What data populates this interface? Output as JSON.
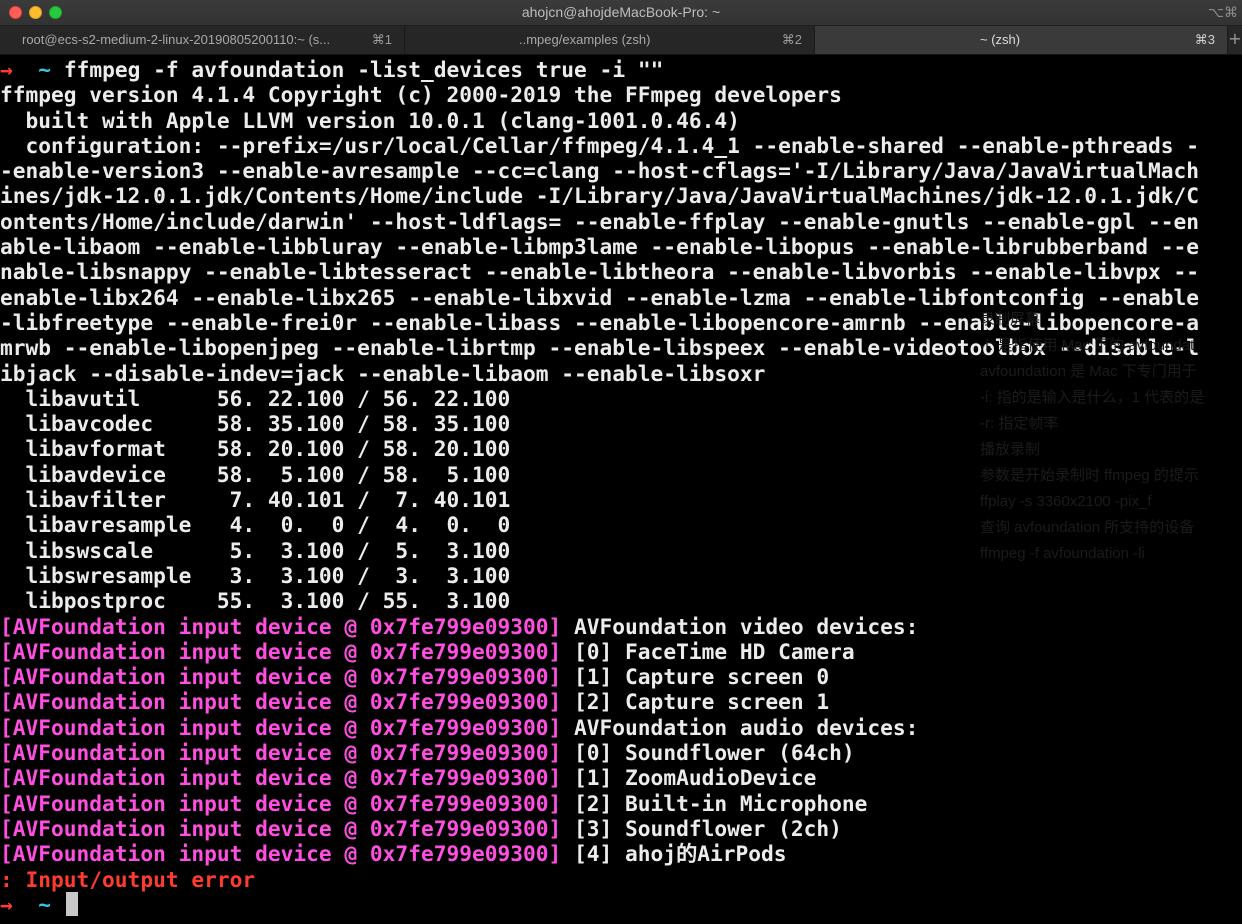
{
  "window": {
    "title": "ahojcn@ahojdeMacBook-Pro: ~",
    "corner_shortcut": "⌥⌘"
  },
  "tabs": [
    {
      "label": "root@ecs-s2-medium-2-linux-20190805200110:~ (s...",
      "shortcut": "⌘1",
      "active": false
    },
    {
      "label": "..mpeg/examples (zsh)",
      "shortcut": "⌘2",
      "active": false
    },
    {
      "label": "~ (zsh)",
      "shortcut": "⌘3",
      "active": true
    }
  ],
  "tab_add": "+",
  "prompt": {
    "arrow": "→",
    "dir": "~"
  },
  "command": "ffmpeg -f avfoundation -list_devices true -i \"\"",
  "banner": [
    "ffmpeg version 4.1.4 Copyright (c) 2000-2019 the FFmpeg developers",
    "  built with Apple LLVM version 10.0.1 (clang-1001.0.46.4)",
    "  configuration: --prefix=/usr/local/Cellar/ffmpeg/4.1.4_1 --enable-shared --enable-pthreads -",
    "-enable-version3 --enable-avresample --cc=clang --host-cflags='-I/Library/Java/JavaVirtualMach",
    "ines/jdk-12.0.1.jdk/Contents/Home/include -I/Library/Java/JavaVirtualMachines/jdk-12.0.1.jdk/C",
    "ontents/Home/include/darwin' --host-ldflags= --enable-ffplay --enable-gnutls --enable-gpl --en",
    "able-libaom --enable-libbluray --enable-libmp3lame --enable-libopus --enable-librubberband --e",
    "nable-libsnappy --enable-libtesseract --enable-libtheora --enable-libvorbis --enable-libvpx --",
    "enable-libx264 --enable-libx265 --enable-libxvid --enable-lzma --enable-libfontconfig --enable",
    "-libfreetype --enable-frei0r --enable-libass --enable-libopencore-amrnb --enable-libopencore-a",
    "mrwb --enable-libopenjpeg --enable-librtmp --enable-libspeex --enable-videotoolbox --disable-l",
    "ibjack --disable-indev=jack --enable-libaom --enable-libsoxr",
    "  libavutil      56. 22.100 / 56. 22.100",
    "  libavcodec     58. 35.100 / 58. 35.100",
    "  libavformat    58. 20.100 / 58. 20.100",
    "  libavdevice    58.  5.100 / 58.  5.100",
    "  libavfilter     7. 40.101 /  7. 40.101",
    "  libavresample   4.  0.  0 /  4.  0.  0",
    "  libswscale      5.  3.100 /  5.  3.100",
    "  libswresample   3.  3.100 /  3.  3.100",
    "  libpostproc    55.  3.100 / 55.  3.100"
  ],
  "device_prefix": "[AVFoundation input device @ 0x7fe799e09300]",
  "devices": [
    " AVFoundation video devices:",
    " [0] FaceTime HD Camera",
    " [1] Capture screen 0",
    " [2] Capture screen 1",
    " AVFoundation audio devices:",
    " [0] Soundflower (64ch)",
    " [1] ZoomAudioDevice",
    " [2] Built-in Microphone",
    " [3] Soundflower (2ch)",
    " [4] ahoj的AirPods"
  ],
  "error_line": ": Input/output error",
  "background_ghost": [
    "录制屏幕",
    "-f: 是指使用 Mac 下的 avfoundat",
    "avfoundation 是 Mac 下专门用于",
    "-i: 指的是输入是什么，1 代表的是",
    "-r: 指定帧率",
    "播放录制",
    "参数是开始录制时 ffmpeg 的提示",
    "ffplay -s 3360x2100 -pix_f",
    "查询 avfoundation 所支持的设备",
    "ffmpeg -f avfoundation -li"
  ],
  "colors": {
    "prompt_arrow": "#ff3b30",
    "prompt_dir": "#34c8e8",
    "device_prefix": "#ff4fe0",
    "error": "#ff3b30"
  }
}
